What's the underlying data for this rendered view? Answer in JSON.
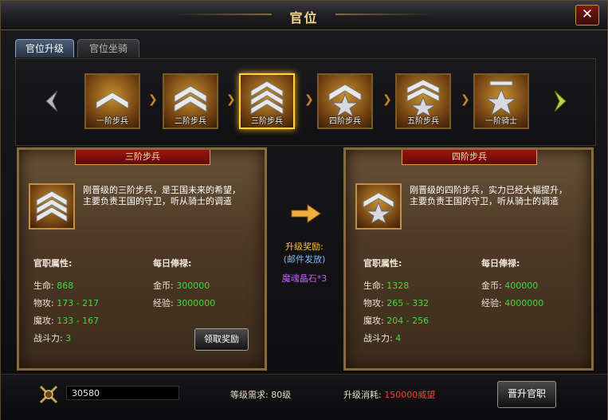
{
  "window": {
    "title": "官位",
    "close_glyph": "✕"
  },
  "tabs": [
    {
      "label": "官位升级",
      "active": true
    },
    {
      "label": "官位坐骑",
      "active": false
    }
  ],
  "ranks": [
    {
      "label": "一阶步兵",
      "icon": "rank-chevron-1-icon",
      "selected": false
    },
    {
      "label": "二阶步兵",
      "icon": "rank-chevron-2-icon",
      "selected": false
    },
    {
      "label": "三阶步兵",
      "icon": "rank-chevron-3-icon",
      "selected": true
    },
    {
      "label": "四阶步兵",
      "icon": "rank-star-1-icon",
      "selected": false
    },
    {
      "label": "五阶步兵",
      "icon": "rank-star-2-icon",
      "selected": false
    },
    {
      "label": "一阶骑士",
      "icon": "rank-knight-icon",
      "selected": false
    }
  ],
  "current": {
    "title": "三阶步兵",
    "desc": "刚晋级的三阶步兵，是王国未来的希望，主要负责王国的守卫，听从骑士的调遣",
    "attr_label": "官职属性:",
    "salary_label": "每日俸禄:",
    "hp_label": "生命:",
    "hp": "868",
    "phys_label": "物攻:",
    "phys": "173 - 217",
    "magic_label": "魔攻:",
    "magic": "133 - 167",
    "power_label": "战斗力:",
    "power": "3",
    "gold_label": "金币:",
    "gold": "300000",
    "exp_label": "经验:",
    "exp": "3000000",
    "claim_button": "领取奖励"
  },
  "next": {
    "title": "四阶步兵",
    "desc": "刚晋级的四阶步兵，实力已经大幅提升，主要负责王国的守卫，听从骑士的调遣",
    "attr_label": "官职属性:",
    "salary_label": "每日俸禄:",
    "hp_label": "生命:",
    "hp": "1328",
    "phys_label": "物攻:",
    "phys": "265 - 332",
    "magic_label": "魔攻:",
    "magic": "204 - 256",
    "power_label": "战斗力:",
    "power": "4",
    "gold_label": "金币:",
    "gold": "400000",
    "exp_label": "经验:",
    "exp": "4000000"
  },
  "middle": {
    "reward_label": "升级奖励:",
    "reward_note": "(邮件发放)",
    "reward_item": "魔魂晶石*3"
  },
  "footer": {
    "prestige_value": "30580",
    "level_req_label": "等级需求:",
    "level_req": "80级",
    "cost_label": "升级消耗:",
    "cost": "150000威望",
    "upgrade_button": "晋升官职"
  },
  "colors": {
    "accent_gold": "#f6c43a",
    "value_green": "#3cdc3c",
    "cost_red": "#ff3c3c",
    "reward_purple": "#c060ff",
    "note_blue": "#7ab8ff"
  }
}
